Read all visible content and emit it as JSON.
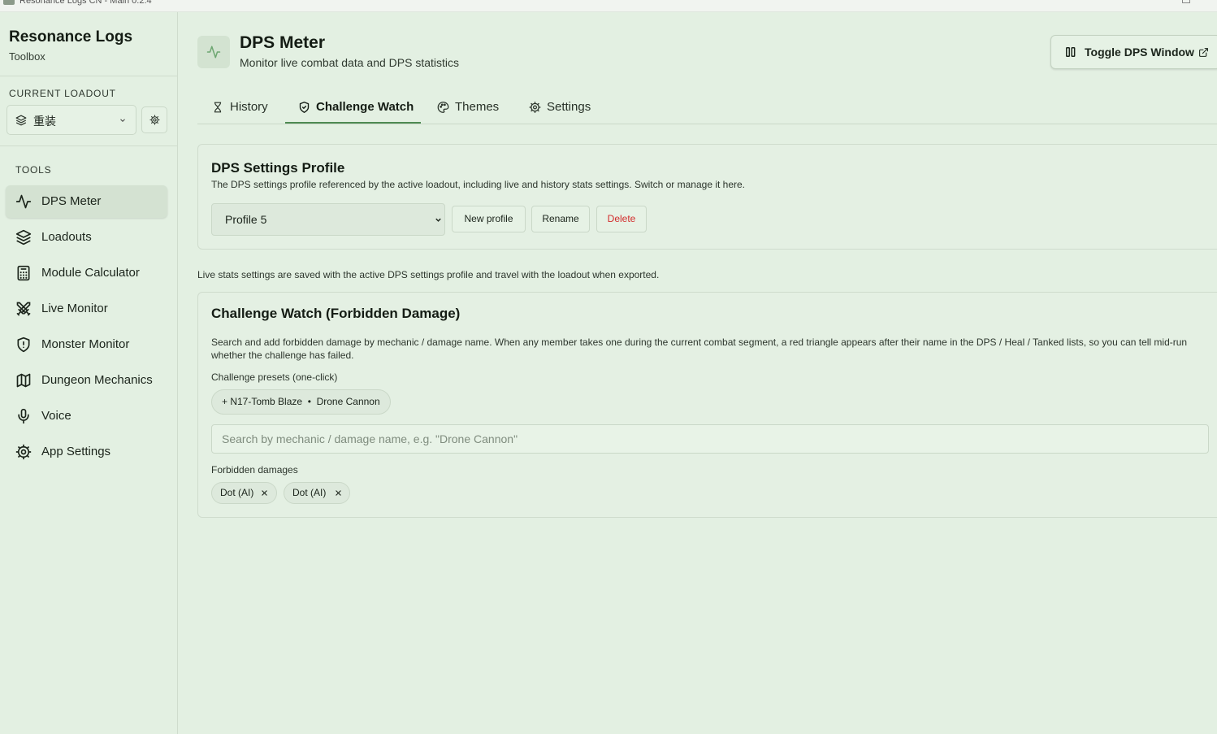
{
  "window": {
    "title": "Resonance Logs CN - Main 0.2.4"
  },
  "sidebar": {
    "brand": {
      "name": "Resonance Logs",
      "subtitle": "Toolbox"
    },
    "loadout": {
      "section_label": "CURRENT LOADOUT",
      "value": "重装"
    },
    "tools_label": "TOOLS",
    "items": [
      {
        "label": "DPS Meter",
        "icon": "activity-icon",
        "active": true
      },
      {
        "label": "Loadouts",
        "icon": "layers-icon"
      },
      {
        "label": "Module Calculator",
        "icon": "calculator-icon"
      },
      {
        "label": "Live Monitor",
        "icon": "swords-icon"
      },
      {
        "label": "Monster Monitor",
        "icon": "shield-icon"
      },
      {
        "label": "Dungeon Mechanics",
        "icon": "map-icon"
      },
      {
        "label": "Voice",
        "icon": "microphone-icon"
      },
      {
        "label": "App Settings",
        "icon": "gear-icon"
      }
    ]
  },
  "header": {
    "title": "DPS Meter",
    "subtitle": "Monitor live combat data and DPS statistics",
    "toggle_button": "Toggle DPS Window"
  },
  "tabs": [
    {
      "label": "History",
      "icon": "hourglass-icon"
    },
    {
      "label": "Challenge Watch",
      "icon": "shield-check-icon",
      "active": true
    },
    {
      "label": "Themes",
      "icon": "palette-icon"
    },
    {
      "label": "Settings",
      "icon": "gear-icon"
    }
  ],
  "profile_card": {
    "title": "DPS Settings Profile",
    "description": "The DPS settings profile referenced by the active loadout, including live and history stats settings. Switch or manage it here.",
    "selected_profile": "Profile 5",
    "new_button": "New profile",
    "rename_button": "Rename",
    "delete_button": "Delete"
  },
  "note": "Live stats settings are saved with the active DPS settings profile and travel with the loadout when exported.",
  "challenge_card": {
    "title": "Challenge Watch (Forbidden Damage)",
    "description": "Search and add forbidden damage by mechanic / damage name. When any member takes one during the current combat segment, a red triangle appears after their name in the DPS / Heal / Tanked lists, so you can tell mid-run whether the challenge has failed.",
    "presets_label": "Challenge presets (one-click)",
    "preset_chip": "+ N17-Tomb Blaze  •  Drone Cannon",
    "search_placeholder": "Search by mechanic / damage name, e.g. \"Drone Cannon\"",
    "forbidden_label": "Forbidden damages",
    "forbidden": [
      {
        "label": "Dot (AI)"
      },
      {
        "label": "Dot (AI)"
      }
    ]
  },
  "colors": {
    "background": "#e3f0e2",
    "accent": "#4e8a52",
    "danger": "#d22b2b"
  }
}
